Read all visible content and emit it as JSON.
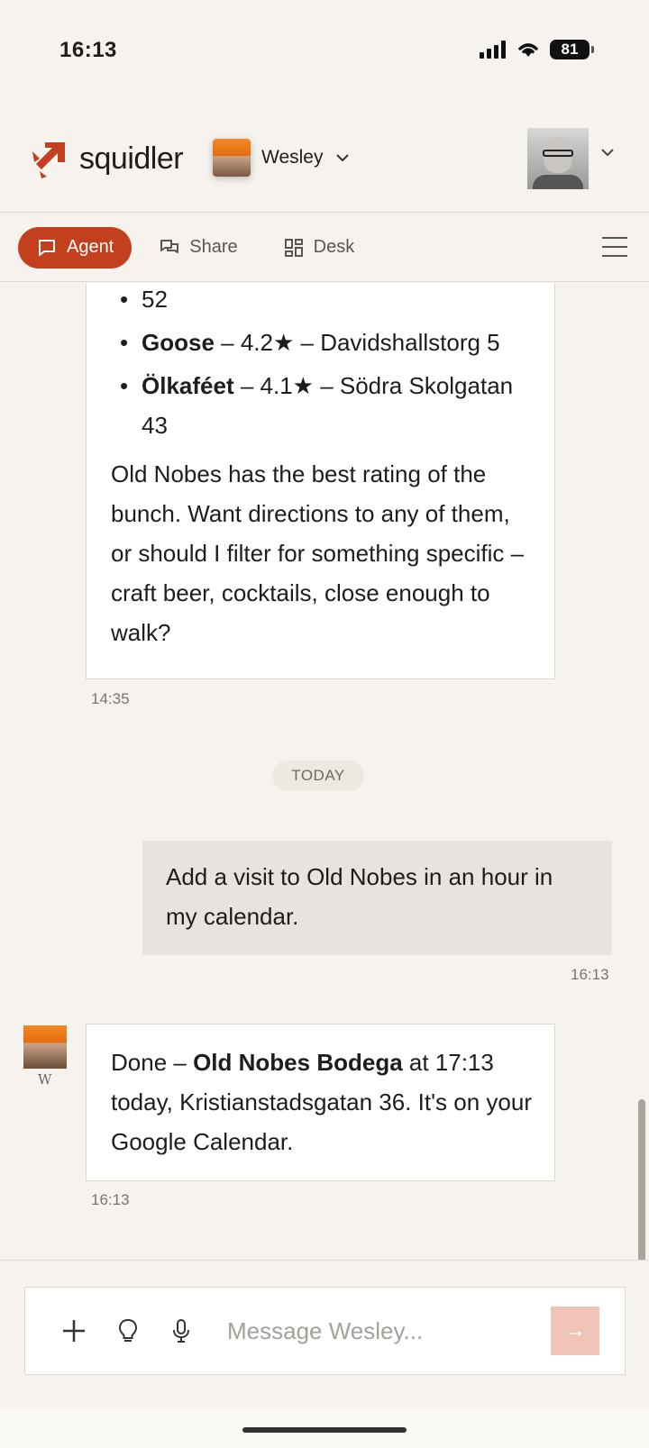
{
  "status_bar": {
    "time": "16:13",
    "battery": "81"
  },
  "header": {
    "logo_text": "squidler",
    "agent_name": "Wesley",
    "icons": {
      "logo": "squid-logo-icon",
      "dropdown": "chevron-down-icon"
    }
  },
  "tabs": [
    {
      "label": "Agent",
      "icon": "chat-bubble-icon",
      "active": true
    },
    {
      "label": "Share",
      "icon": "chat-bubbles-icon",
      "active": false
    },
    {
      "label": "Desk",
      "icon": "grid-icon",
      "active": false
    }
  ],
  "messages": {
    "first": {
      "list_tail": "52",
      "items": [
        {
          "name": "Goose",
          "detail": " – 4.2★ – Davidshallstorg 5"
        },
        {
          "name": "Ölkaféet",
          "detail": " – 4.1★ – Södra Skolgatan 43"
        }
      ],
      "body": "Old Nobes has the best rating of the bunch. Want directions to any of them, or should I filter for something specific – craft beer, cocktails, close enough to walk?",
      "time": "14:35"
    },
    "divider": "TODAY",
    "user": {
      "text": "Add a visit to Old Nobes in an hour in my calendar.",
      "time": "16:13"
    },
    "reply": {
      "prefix": "Done – ",
      "bold": "Old Nobes Bodega",
      "suffix": " at 17:13 today, Kristianstadsgatan 36. It's on your Google Calendar.",
      "time": "16:13",
      "avatar_initial": "W"
    }
  },
  "composer": {
    "placeholder": "Message Wesley...",
    "value": "",
    "send_symbol": "→"
  },
  "colors": {
    "accent": "#c3401e",
    "send_disabled": "#f0c4b6",
    "background": "#f6f3ee"
  }
}
